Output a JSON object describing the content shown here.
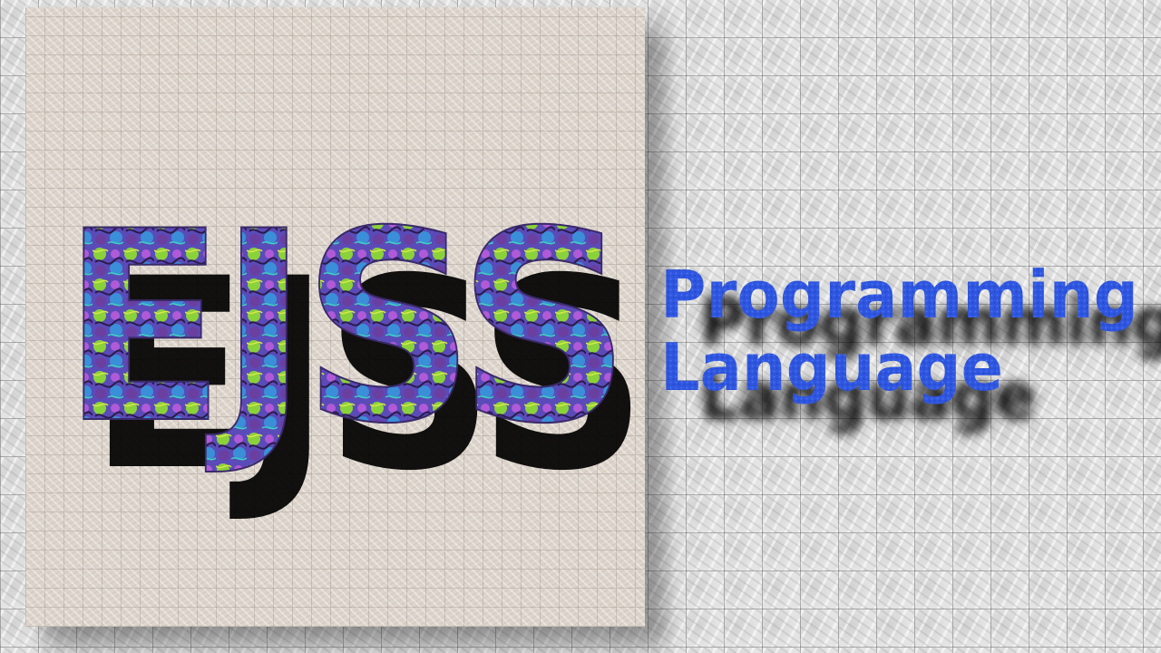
{
  "logo": {
    "main_word": "EJSS",
    "tagline_line1": "Programming",
    "tagline_line2": "Language"
  },
  "colors": {
    "page_background": "#e4e4e4",
    "panel_background": "#ddd5cc",
    "logo_shadow": "#000000",
    "logo_fill_purple": "#7a4fd0",
    "logo_fill_green": "#8ad23a",
    "logo_fill_blue": "#3a6fd8",
    "tagline_blue": "#2f56e0"
  },
  "icons": {
    "background": "marble-tile-texture",
    "panel": "stone-tile-texture"
  }
}
